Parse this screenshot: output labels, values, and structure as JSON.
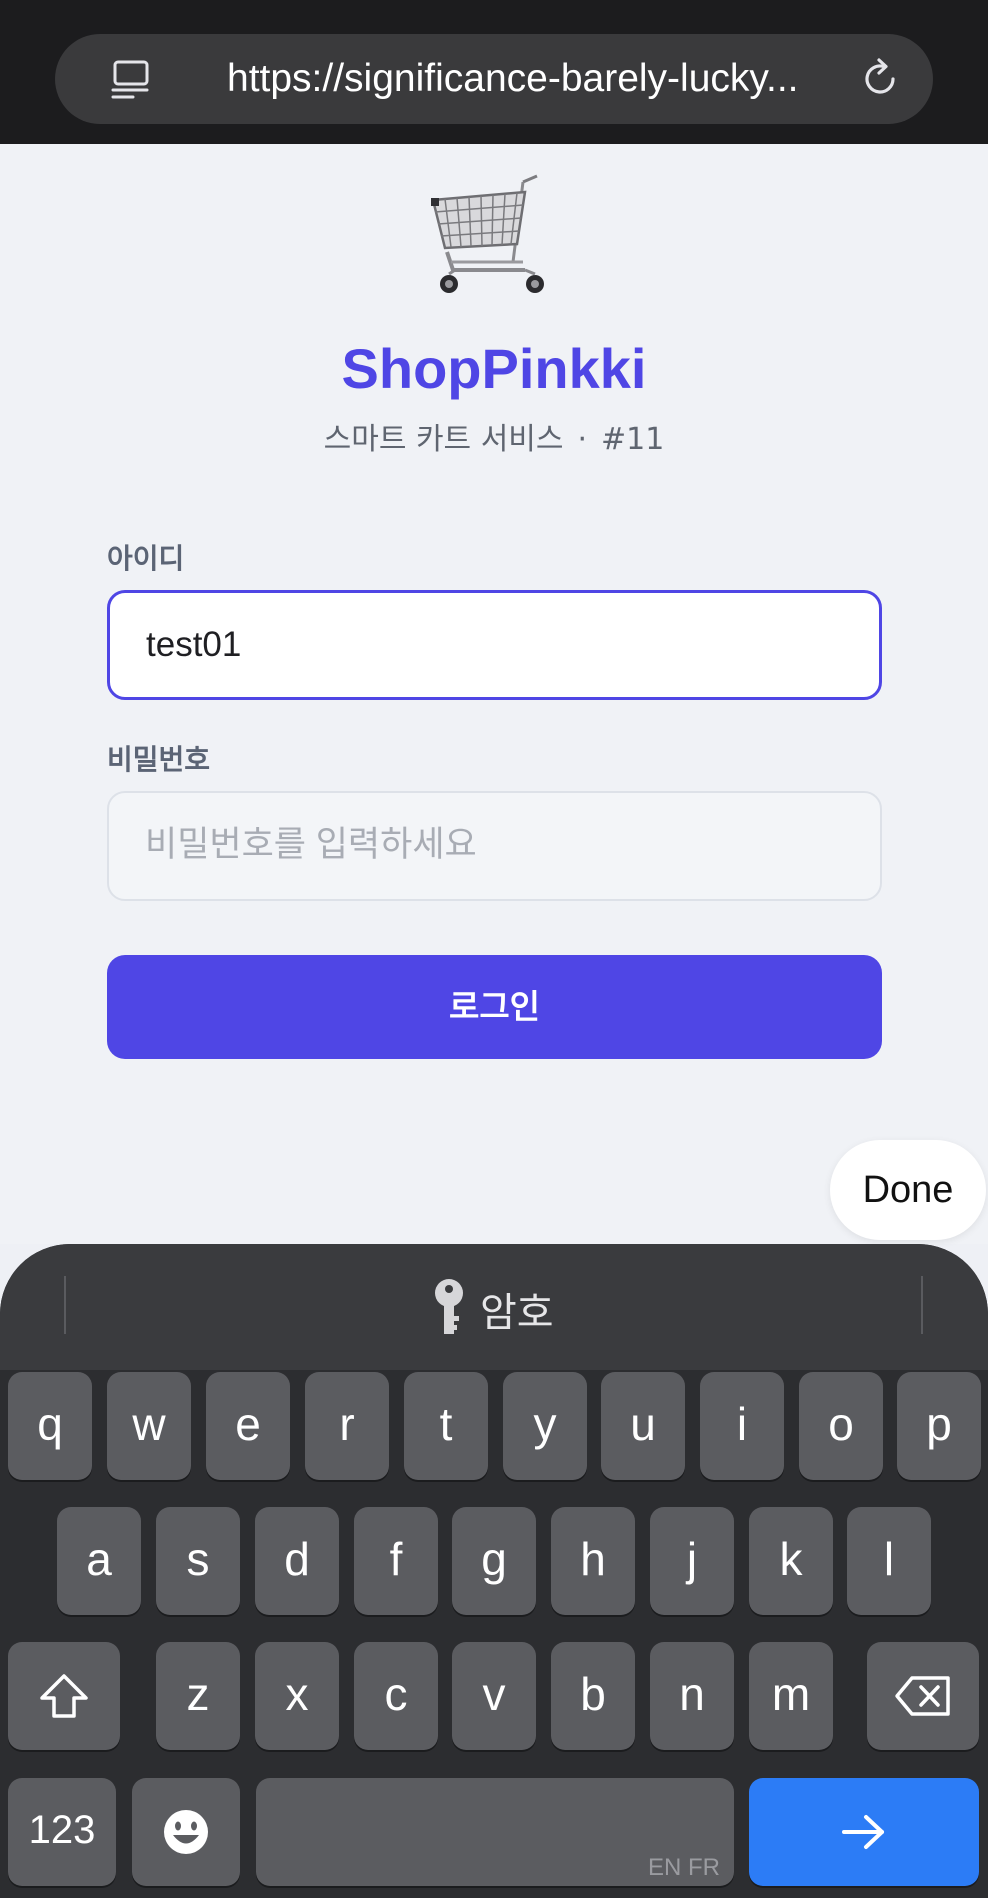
{
  "browser": {
    "url": "https://significance-barely-lucky..."
  },
  "app": {
    "brand": "ShopPinkki",
    "subtitle_service": "스마트 카트 서비스",
    "subtitle_dot": "·",
    "subtitle_number": "#11"
  },
  "form": {
    "id_label": "아이디",
    "id_value": "test01",
    "password_label": "비밀번호",
    "password_placeholder": "비밀번호를 입력하세요",
    "login_label": "로그인"
  },
  "done_label": "Done",
  "keyboard": {
    "suggestion": "암호",
    "row1": [
      "q",
      "w",
      "e",
      "r",
      "t",
      "y",
      "u",
      "i",
      "o",
      "p"
    ],
    "row2": [
      "a",
      "s",
      "d",
      "f",
      "g",
      "h",
      "j",
      "k",
      "l"
    ],
    "row3": [
      "z",
      "x",
      "c",
      "v",
      "b",
      "n",
      "m"
    ],
    "numbers_label": "123",
    "space_hint": "EN FR"
  },
  "icons": {
    "page": "page-menu-icon",
    "reload": "reload-icon",
    "cart": "shopping-cart-icon",
    "key": "key-icon",
    "shift": "shift-icon",
    "backspace": "backspace-icon",
    "emoji": "emoji-icon",
    "go": "arrow-right-icon"
  },
  "colors": {
    "accent": "#4f46e5",
    "enter_key": "#2c7cf6"
  }
}
